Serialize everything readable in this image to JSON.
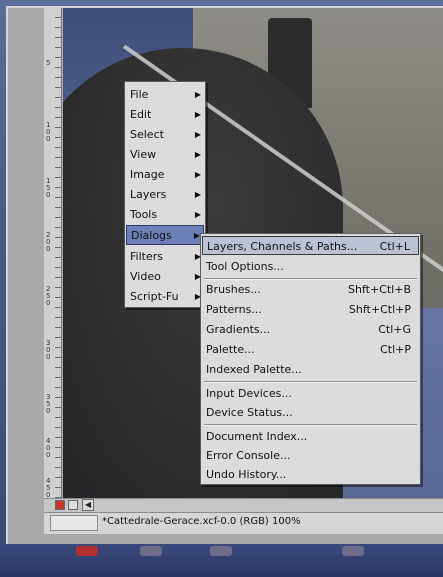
{
  "main_menu": {
    "items": [
      {
        "label": "File"
      },
      {
        "label": "Edit"
      },
      {
        "label": "Select"
      },
      {
        "label": "View"
      },
      {
        "label": "Image"
      },
      {
        "label": "Layers"
      },
      {
        "label": "Tools"
      },
      {
        "label": "Dialogs"
      },
      {
        "label": "Filters"
      },
      {
        "label": "Video"
      },
      {
        "label": "Script-Fu"
      }
    ],
    "arrow_glyph": "▶"
  },
  "dialogs_submenu": {
    "items": [
      {
        "label": "Layers, Channels & Paths...",
        "accel": "Ctl+L"
      },
      {
        "label": "Tool Options...",
        "accel": ""
      },
      {
        "label": "Brushes...",
        "accel": "Shft+Ctl+B"
      },
      {
        "label": "Patterns...",
        "accel": "Shft+Ctl+P"
      },
      {
        "label": "Gradients...",
        "accel": "Ctl+G"
      },
      {
        "label": "Palette...",
        "accel": "Ctl+P"
      },
      {
        "label": "Indexed Palette...",
        "accel": ""
      },
      {
        "label": "Input Devices...",
        "accel": ""
      },
      {
        "label": "Device Status...",
        "accel": ""
      },
      {
        "label": "Document Index...",
        "accel": ""
      },
      {
        "label": "Error Console...",
        "accel": ""
      },
      {
        "label": "Undo History...",
        "accel": ""
      }
    ]
  },
  "statusbar": {
    "title": "*Cattedrale-Gerace.xcf-0.0 (RGB) 100%"
  },
  "ruler": {
    "labels": [
      "5",
      "1\n0\n0",
      "1\n5\n0",
      "2\n0\n0",
      "2\n5\n0",
      "3\n0\n0",
      "3\n5\n0",
      "4\n0\n0",
      "4\n5\n0"
    ]
  },
  "colors": {
    "menu_bg": "#dcdcdc",
    "menu_highlight": "#6c7fb6",
    "submenu_highlight": "#bcc2d6"
  }
}
